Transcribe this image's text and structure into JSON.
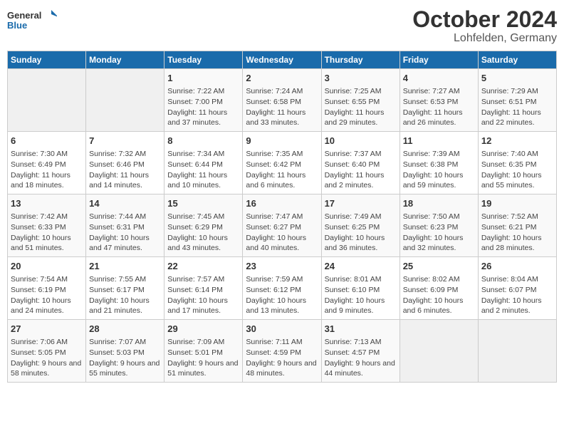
{
  "header": {
    "logo_line1": "General",
    "logo_line2": "Blue",
    "title": "October 2024",
    "subtitle": "Lohfelden, Germany"
  },
  "weekdays": [
    "Sunday",
    "Monday",
    "Tuesday",
    "Wednesday",
    "Thursday",
    "Friday",
    "Saturday"
  ],
  "weeks": [
    [
      {
        "day": "",
        "text": ""
      },
      {
        "day": "",
        "text": ""
      },
      {
        "day": "1",
        "text": "Sunrise: 7:22 AM\nSunset: 7:00 PM\nDaylight: 11 hours and 37 minutes."
      },
      {
        "day": "2",
        "text": "Sunrise: 7:24 AM\nSunset: 6:58 PM\nDaylight: 11 hours and 33 minutes."
      },
      {
        "day": "3",
        "text": "Sunrise: 7:25 AM\nSunset: 6:55 PM\nDaylight: 11 hours and 29 minutes."
      },
      {
        "day": "4",
        "text": "Sunrise: 7:27 AM\nSunset: 6:53 PM\nDaylight: 11 hours and 26 minutes."
      },
      {
        "day": "5",
        "text": "Sunrise: 7:29 AM\nSunset: 6:51 PM\nDaylight: 11 hours and 22 minutes."
      }
    ],
    [
      {
        "day": "6",
        "text": "Sunrise: 7:30 AM\nSunset: 6:49 PM\nDaylight: 11 hours and 18 minutes."
      },
      {
        "day": "7",
        "text": "Sunrise: 7:32 AM\nSunset: 6:46 PM\nDaylight: 11 hours and 14 minutes."
      },
      {
        "day": "8",
        "text": "Sunrise: 7:34 AM\nSunset: 6:44 PM\nDaylight: 11 hours and 10 minutes."
      },
      {
        "day": "9",
        "text": "Sunrise: 7:35 AM\nSunset: 6:42 PM\nDaylight: 11 hours and 6 minutes."
      },
      {
        "day": "10",
        "text": "Sunrise: 7:37 AM\nSunset: 6:40 PM\nDaylight: 11 hours and 2 minutes."
      },
      {
        "day": "11",
        "text": "Sunrise: 7:39 AM\nSunset: 6:38 PM\nDaylight: 10 hours and 59 minutes."
      },
      {
        "day": "12",
        "text": "Sunrise: 7:40 AM\nSunset: 6:35 PM\nDaylight: 10 hours and 55 minutes."
      }
    ],
    [
      {
        "day": "13",
        "text": "Sunrise: 7:42 AM\nSunset: 6:33 PM\nDaylight: 10 hours and 51 minutes."
      },
      {
        "day": "14",
        "text": "Sunrise: 7:44 AM\nSunset: 6:31 PM\nDaylight: 10 hours and 47 minutes."
      },
      {
        "day": "15",
        "text": "Sunrise: 7:45 AM\nSunset: 6:29 PM\nDaylight: 10 hours and 43 minutes."
      },
      {
        "day": "16",
        "text": "Sunrise: 7:47 AM\nSunset: 6:27 PM\nDaylight: 10 hours and 40 minutes."
      },
      {
        "day": "17",
        "text": "Sunrise: 7:49 AM\nSunset: 6:25 PM\nDaylight: 10 hours and 36 minutes."
      },
      {
        "day": "18",
        "text": "Sunrise: 7:50 AM\nSunset: 6:23 PM\nDaylight: 10 hours and 32 minutes."
      },
      {
        "day": "19",
        "text": "Sunrise: 7:52 AM\nSunset: 6:21 PM\nDaylight: 10 hours and 28 minutes."
      }
    ],
    [
      {
        "day": "20",
        "text": "Sunrise: 7:54 AM\nSunset: 6:19 PM\nDaylight: 10 hours and 24 minutes."
      },
      {
        "day": "21",
        "text": "Sunrise: 7:55 AM\nSunset: 6:17 PM\nDaylight: 10 hours and 21 minutes."
      },
      {
        "day": "22",
        "text": "Sunrise: 7:57 AM\nSunset: 6:14 PM\nDaylight: 10 hours and 17 minutes."
      },
      {
        "day": "23",
        "text": "Sunrise: 7:59 AM\nSunset: 6:12 PM\nDaylight: 10 hours and 13 minutes."
      },
      {
        "day": "24",
        "text": "Sunrise: 8:01 AM\nSunset: 6:10 PM\nDaylight: 10 hours and 9 minutes."
      },
      {
        "day": "25",
        "text": "Sunrise: 8:02 AM\nSunset: 6:09 PM\nDaylight: 10 hours and 6 minutes."
      },
      {
        "day": "26",
        "text": "Sunrise: 8:04 AM\nSunset: 6:07 PM\nDaylight: 10 hours and 2 minutes."
      }
    ],
    [
      {
        "day": "27",
        "text": "Sunrise: 7:06 AM\nSunset: 5:05 PM\nDaylight: 9 hours and 58 minutes."
      },
      {
        "day": "28",
        "text": "Sunrise: 7:07 AM\nSunset: 5:03 PM\nDaylight: 9 hours and 55 minutes."
      },
      {
        "day": "29",
        "text": "Sunrise: 7:09 AM\nSunset: 5:01 PM\nDaylight: 9 hours and 51 minutes."
      },
      {
        "day": "30",
        "text": "Sunrise: 7:11 AM\nSunset: 4:59 PM\nDaylight: 9 hours and 48 minutes."
      },
      {
        "day": "31",
        "text": "Sunrise: 7:13 AM\nSunset: 4:57 PM\nDaylight: 9 hours and 44 minutes."
      },
      {
        "day": "",
        "text": ""
      },
      {
        "day": "",
        "text": ""
      }
    ]
  ]
}
